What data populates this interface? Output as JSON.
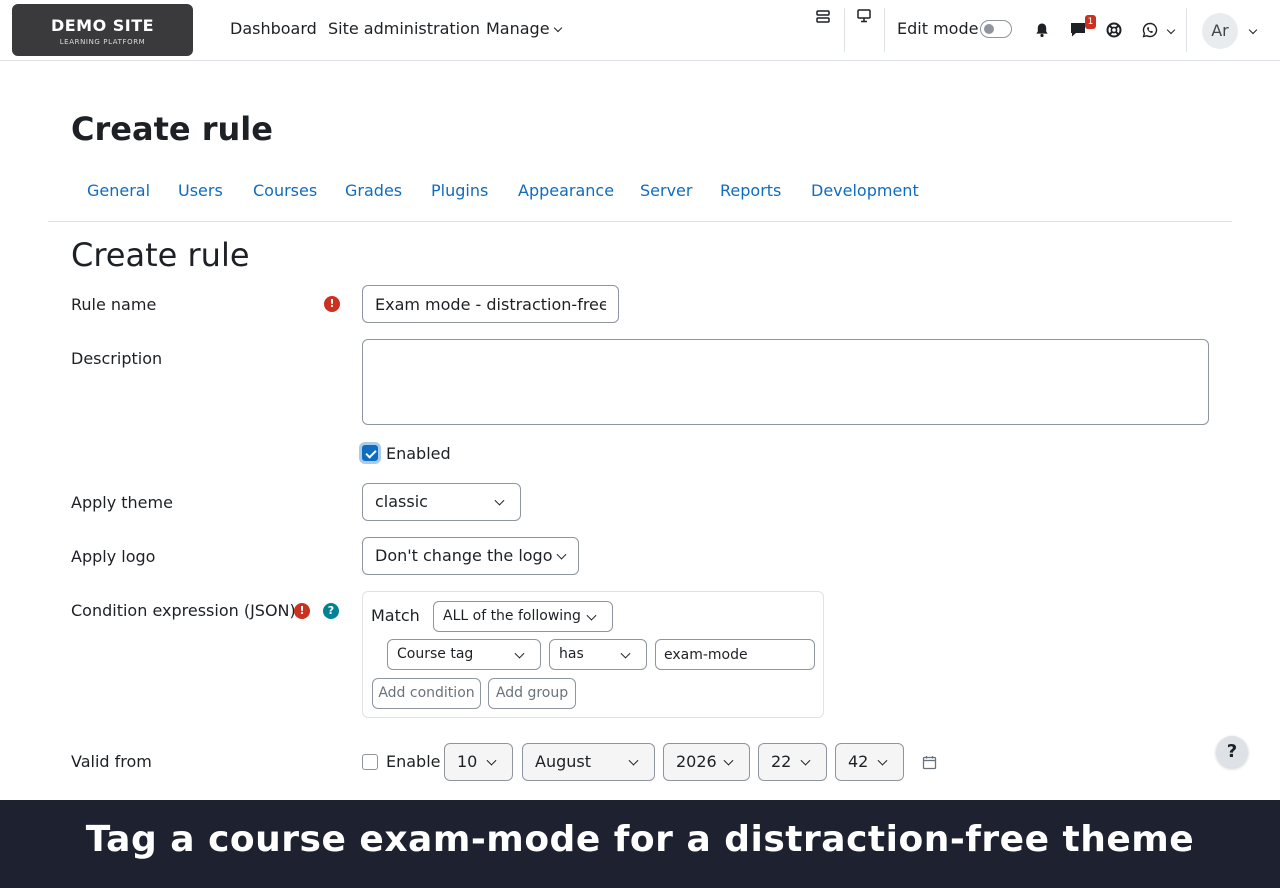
{
  "navbar": {
    "logo_title": "DEMO SITE",
    "logo_subtitle": "LEARNING PLATFORM",
    "links": {
      "dashboard": "Dashboard",
      "site_admin": "Site administration",
      "manage": "Manage"
    },
    "edit_mode_label": "Edit mode",
    "edit_mode_on": false,
    "messages_badge": "1",
    "avatar_initials": "Ar"
  },
  "page": {
    "header": "Create rule",
    "form_heading": "Create rule"
  },
  "tabs": [
    "General",
    "Users",
    "Courses",
    "Grades",
    "Plugins",
    "Appearance",
    "Server",
    "Reports",
    "Development"
  ],
  "form": {
    "rule_name": {
      "label": "Rule name",
      "value": "Exam mode - distraction-free"
    },
    "description": {
      "label": "Description",
      "value": ""
    },
    "enabled": {
      "label": "Enabled",
      "checked": true
    },
    "apply_theme": {
      "label": "Apply theme",
      "value": "classic"
    },
    "apply_logo": {
      "label": "Apply logo",
      "value": "Don't change the logo"
    },
    "condition": {
      "label": "Condition expression (JSON)",
      "match_label": "Match",
      "match_value": "ALL of the following",
      "field": "Course tag",
      "operator": "has",
      "value": "exam-mode",
      "add_condition": "Add condition",
      "add_group": "Add group"
    },
    "valid_from": {
      "label": "Valid from",
      "enable_label": "Enable",
      "enabled": false,
      "day": "10",
      "month": "August",
      "year": "2026",
      "hour": "22",
      "minute": "42"
    }
  },
  "help_button": "?",
  "caption": "Tag a course exam-mode for a distraction-free theme",
  "colors": {
    "link": "#0f6cbf",
    "required": "#ca3120",
    "help": "#008196",
    "caption_bg": "#1e2130"
  }
}
